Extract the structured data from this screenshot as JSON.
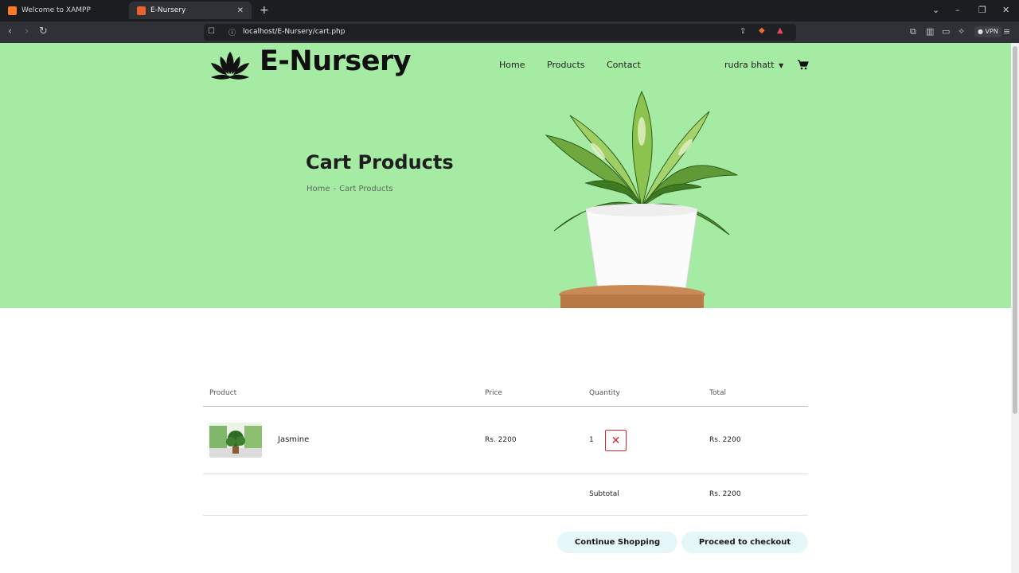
{
  "browser": {
    "tabs": [
      {
        "title": "Welcome to XAMPP",
        "active": false
      },
      {
        "title": "E-Nursery",
        "active": true
      }
    ],
    "new_tab_label": "+",
    "url": "localhost/E-Nursery/cart.php",
    "vpn_label": "VPN"
  },
  "site": {
    "brand": "E-Nursery",
    "nav": [
      "Home",
      "Products",
      "Contact"
    ],
    "user_name": "rudra bhatt",
    "accent_bg": "#a5eba3"
  },
  "hero": {
    "title": "Cart Products",
    "breadcrumb": {
      "home": "Home",
      "separator": "-",
      "current": "Cart Products"
    }
  },
  "cart": {
    "headers": {
      "product": "Product",
      "price": "Price",
      "quantity": "Quantity",
      "total": "Total"
    },
    "items": [
      {
        "name": "Jasmine",
        "price": "Rs. 2200",
        "quantity": "1",
        "total": "Rs. 2200"
      }
    ],
    "subtotal_label": "Subtotal",
    "subtotal_value": "Rs. 2200",
    "continue_label": "Continue Shopping",
    "checkout_label": "Proceed to checkout"
  },
  "colors": {
    "remove": "#d22a2a",
    "button_bg": "#e5f7f8"
  }
}
